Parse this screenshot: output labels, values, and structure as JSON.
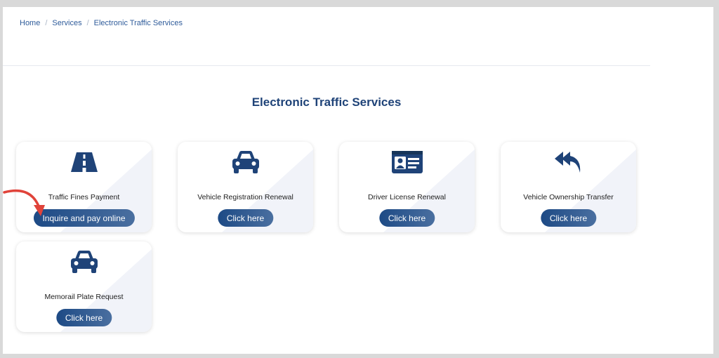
{
  "breadcrumb": {
    "items": [
      "Home",
      "Services",
      "Electronic Traffic Services"
    ],
    "separator": "/"
  },
  "page": {
    "title": "Electronic Traffic Services"
  },
  "services": [
    {
      "icon": "road-icon",
      "label": "Traffic Fines Payment",
      "button": "Inquire and pay online"
    },
    {
      "icon": "car-icon",
      "label": "Vehicle Registration Renewal",
      "button": "Click here"
    },
    {
      "icon": "id-card-icon",
      "label": "Driver License Renewal",
      "button": "Click here"
    },
    {
      "icon": "reply-all-icon",
      "label": "Vehicle Ownership Transfer",
      "button": "Click here"
    },
    {
      "icon": "car-icon",
      "label": "Memorail Plate Request",
      "button": "Click here"
    }
  ],
  "colors": {
    "accent": "#1f4378",
    "button_start": "#1d4a85",
    "button_end": "#4a6fa0",
    "annotation_arrow": "#e0433a"
  }
}
